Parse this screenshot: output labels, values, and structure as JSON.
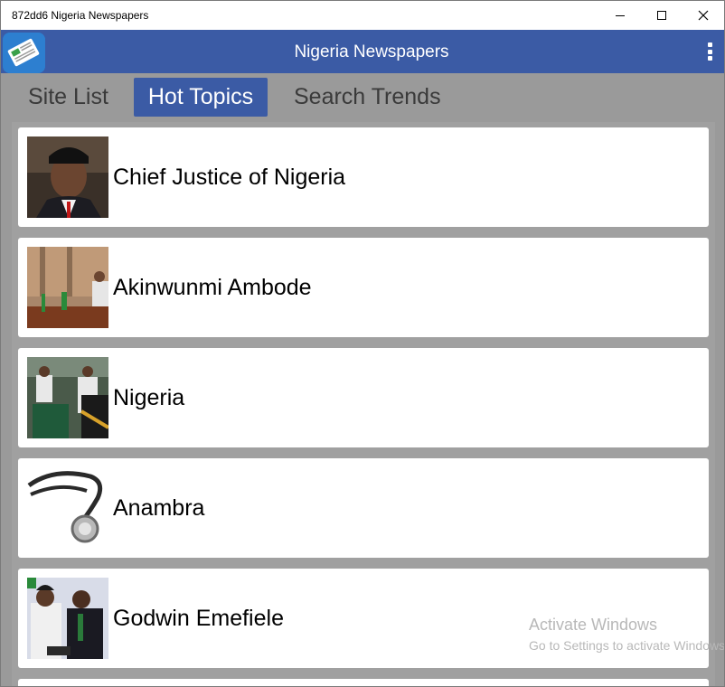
{
  "window": {
    "title": "872dd6 Nigeria Newspapers"
  },
  "app": {
    "title": "Nigeria Newspapers",
    "accent": "#3b5ba5"
  },
  "tabs": [
    {
      "label": "Site List",
      "selected": false
    },
    {
      "label": "Hot Topics",
      "selected": true
    },
    {
      "label": "Search Trends",
      "selected": false
    }
  ],
  "topics": [
    {
      "label": "Chief Justice of Nigeria",
      "thumb": "portrait-photo"
    },
    {
      "label": "Akinwunmi Ambode",
      "thumb": "meeting-photo"
    },
    {
      "label": "Nigeria",
      "thumb": "ceremony-photo"
    },
    {
      "label": "Anambra",
      "thumb": "stethoscope-photo"
    },
    {
      "label": "Godwin Emefiele",
      "thumb": "officials-photo"
    }
  ],
  "watermark": {
    "line1": "Activate Windows",
    "line2": "Go to Settings to activate Windows."
  }
}
